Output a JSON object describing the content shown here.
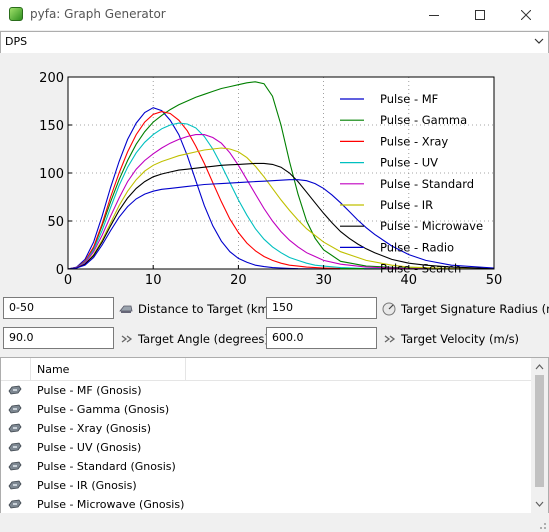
{
  "window": {
    "title": "pyfa: Graph Generator"
  },
  "graph_select": {
    "value": "DPS"
  },
  "chart_data": {
    "type": "line",
    "xlim": [
      0,
      50
    ],
    "ylim": [
      0,
      200
    ],
    "xticks": [
      0,
      10,
      20,
      30,
      40,
      50
    ],
    "yticks": [
      0,
      50,
      100,
      150,
      200
    ],
    "grid": true,
    "legend_position": "top-right",
    "series": [
      {
        "name": "Pulse - MF",
        "color": "#0000cc",
        "x": [
          0,
          1,
          2,
          3,
          4,
          5,
          6,
          7,
          8,
          9,
          10,
          11,
          12,
          13,
          14,
          15,
          16,
          17,
          18,
          19,
          20,
          21,
          22,
          23,
          24,
          25,
          26,
          27,
          28,
          30,
          35,
          40,
          50
        ],
        "y": [
          0,
          2,
          10,
          28,
          55,
          85,
          112,
          135,
          152,
          163,
          168,
          165,
          155,
          140,
          118,
          92,
          66,
          45,
          29,
          18,
          11,
          7,
          4,
          2.5,
          1.5,
          1,
          0.6,
          0.3,
          0.2,
          0.1,
          0,
          0,
          0
        ]
      },
      {
        "name": "Pulse - Gamma",
        "color": "#008000",
        "x": [
          0,
          1,
          2,
          3,
          4,
          5,
          6,
          7,
          8,
          9,
          10,
          11,
          12,
          13,
          14,
          15,
          16,
          17,
          18,
          19,
          20,
          21,
          22,
          23,
          24,
          25,
          26,
          27,
          28,
          29,
          30,
          32,
          35,
          40,
          50
        ],
        "y": [
          0,
          1.5,
          8,
          22,
          45,
          70,
          93,
          113,
          130,
          143,
          153,
          160,
          166,
          171,
          175,
          179,
          182,
          185,
          188,
          190,
          192,
          194,
          195,
          193,
          180,
          150,
          112,
          78,
          50,
          32,
          20,
          8,
          3,
          1,
          0
        ]
      },
      {
        "name": "Pulse - Xray",
        "color": "#ff0000",
        "x": [
          0,
          1,
          2,
          3,
          4,
          5,
          6,
          7,
          8,
          9,
          10,
          11,
          12,
          13,
          14,
          15,
          16,
          17,
          18,
          19,
          20,
          21,
          22,
          23,
          24,
          25,
          26,
          27,
          28,
          29,
          30,
          32,
          35,
          40,
          50
        ],
        "y": [
          0,
          1.5,
          8,
          23,
          47,
          75,
          100,
          122,
          140,
          153,
          161,
          164,
          162,
          155,
          144,
          128,
          110,
          90,
          70,
          52,
          38,
          27,
          19,
          13,
          9,
          6,
          4,
          3,
          2,
          1.5,
          1,
          0.5,
          0.2,
          0,
          0
        ]
      },
      {
        "name": "Pulse - UV",
        "color": "#00c0c0",
        "x": [
          0,
          1,
          2,
          3,
          4,
          5,
          6,
          7,
          8,
          9,
          10,
          11,
          12,
          13,
          14,
          15,
          16,
          17,
          18,
          19,
          20,
          21,
          22,
          23,
          24,
          25,
          26,
          27,
          28,
          29,
          30,
          32,
          35,
          40,
          50
        ],
        "y": [
          0,
          1.5,
          7,
          20,
          40,
          64,
          87,
          106,
          121,
          132,
          140,
          146,
          150,
          152,
          151,
          147,
          138,
          125,
          108,
          90,
          72,
          56,
          42,
          31,
          23,
          17,
          12,
          9,
          6,
          4,
          3,
          1.5,
          0.5,
          0,
          0
        ]
      },
      {
        "name": "Pulse - Standard",
        "color": "#c000c0",
        "x": [
          0,
          1,
          2,
          3,
          4,
          5,
          6,
          7,
          8,
          9,
          10,
          11,
          12,
          13,
          14,
          15,
          16,
          17,
          18,
          19,
          20,
          21,
          22,
          23,
          24,
          25,
          26,
          27,
          28,
          29,
          30,
          32,
          35,
          40,
          50
        ],
        "y": [
          0,
          1.5,
          6,
          18,
          35,
          55,
          74,
          91,
          104,
          113,
          120,
          126,
          131,
          135,
          138,
          140,
          140,
          137,
          131,
          121,
          108,
          93,
          78,
          63,
          50,
          39,
          30,
          23,
          17,
          13,
          9,
          5,
          2,
          0.5,
          0
        ]
      },
      {
        "name": "Pulse - IR",
        "color": "#c0c000",
        "x": [
          0,
          1,
          2,
          3,
          4,
          5,
          6,
          7,
          8,
          9,
          10,
          11,
          12,
          13,
          14,
          15,
          16,
          17,
          18,
          19,
          20,
          21,
          22,
          23,
          24,
          25,
          26,
          27,
          28,
          29,
          30,
          32,
          35,
          38,
          40,
          45,
          50
        ],
        "y": [
          0,
          1,
          5,
          15,
          30,
          48,
          66,
          81,
          93,
          102,
          108,
          112,
          115,
          118,
          120,
          122,
          124,
          125,
          126,
          125,
          122,
          116,
          107,
          96,
          84,
          72,
          61,
          51,
          42,
          35,
          28,
          18,
          9,
          4,
          2,
          0.5,
          0
        ]
      },
      {
        "name": "Pulse - Microwave",
        "color": "#000000",
        "x": [
          0,
          1,
          2,
          3,
          4,
          5,
          6,
          7,
          8,
          9,
          10,
          11,
          12,
          13,
          14,
          15,
          16,
          17,
          18,
          19,
          20,
          21,
          22,
          23,
          24,
          25,
          26,
          27,
          28,
          29,
          30,
          31,
          32,
          33,
          34,
          35,
          36,
          38,
          40,
          42,
          45,
          50
        ],
        "y": [
          0,
          1,
          5,
          14,
          28,
          45,
          61,
          74,
          84,
          91,
          96,
          99,
          101,
          103,
          104,
          105,
          106,
          107,
          108,
          108.5,
          109,
          109.5,
          110,
          110,
          109,
          106,
          100,
          91,
          80,
          69,
          58,
          48,
          39,
          32,
          26,
          21,
          17,
          10,
          6,
          4,
          2,
          0.5
        ]
      },
      {
        "name": "Pulse - Radio",
        "color": "#0000cc",
        "x": [
          0,
          1,
          2,
          3,
          4,
          5,
          6,
          7,
          8,
          9,
          10,
          11,
          12,
          13,
          14,
          15,
          16,
          17,
          18,
          19,
          20,
          21,
          22,
          23,
          24,
          25,
          26,
          27,
          28,
          29,
          30,
          31,
          32,
          33,
          34,
          35,
          36,
          38,
          40,
          42,
          45,
          50
        ],
        "y": [
          0,
          1,
          4,
          12,
          25,
          40,
          54,
          65,
          73,
          78,
          81,
          83,
          84,
          85,
          86,
          87,
          88,
          88.5,
          89,
          89.5,
          90,
          90.5,
          91,
          91.5,
          92,
          92.5,
          93,
          93,
          92,
          89,
          84,
          77,
          69,
          60,
          51,
          43,
          36,
          24,
          15,
          9,
          4,
          1
        ]
      },
      {
        "name": "Pulse - Search",
        "color": "#008000",
        "x": [
          0,
          10,
          20,
          30,
          40,
          50
        ],
        "y": [
          0,
          0,
          0,
          0,
          0,
          0
        ]
      }
    ]
  },
  "inputs": {
    "distance": {
      "value": "0-50",
      "label": "Distance to Target (km)"
    },
    "sig_radius": {
      "value": "150",
      "label": "Target Signature Radius (m)"
    },
    "angle": {
      "value": "90.0",
      "label": "Target Angle (degrees)"
    },
    "velocity": {
      "value": "600.0",
      "label": "Target Velocity (m/s)"
    }
  },
  "fit_list": {
    "column_header": "Name",
    "items": [
      "Pulse - MF (Gnosis)",
      "Pulse - Gamma (Gnosis)",
      "Pulse - Xray (Gnosis)",
      "Pulse - UV (Gnosis)",
      "Pulse - Standard (Gnosis)",
      "Pulse - IR (Gnosis)",
      "Pulse - Microwave (Gnosis)"
    ]
  }
}
